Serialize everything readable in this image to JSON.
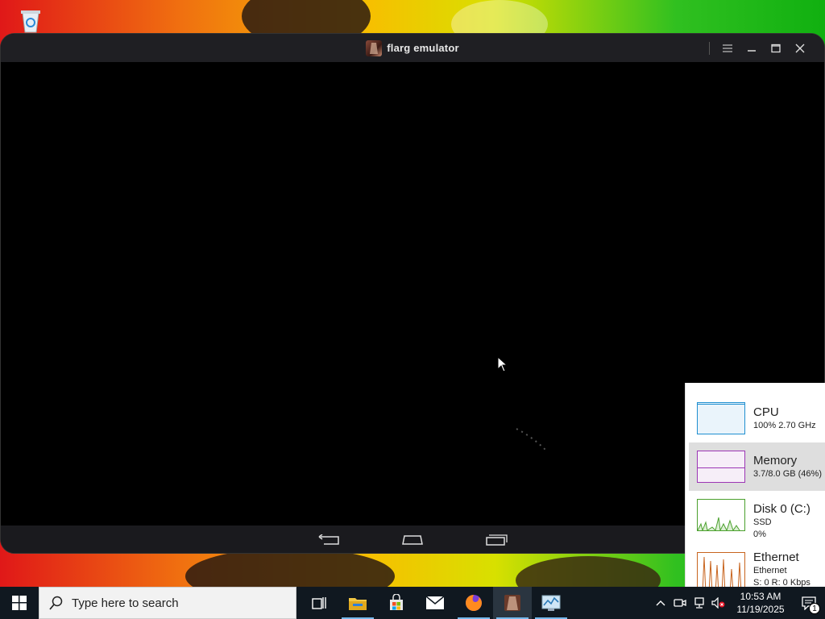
{
  "desktop": {
    "recycle_bin_icon": "recycle-bin-icon"
  },
  "emulator": {
    "title": "flarg emulator",
    "controls": [
      "menu-icon",
      "minimize-icon",
      "maximize-icon",
      "close-icon"
    ],
    "navbar": [
      "back-icon",
      "home-icon",
      "recents-icon"
    ]
  },
  "perf_panel": {
    "items": [
      {
        "name": "CPU",
        "line1": "100%  2.70 GHz",
        "line2": "",
        "color": "#1f8fd0"
      },
      {
        "name": "Memory",
        "line1": "3.7/8.0 GB (46%)",
        "line2": "",
        "color": "#9c36b5"
      },
      {
        "name": "Disk 0 (C:)",
        "line1": "SSD",
        "line2": "0%",
        "color": "#4aa02c"
      },
      {
        "name": "Ethernet",
        "line1": "Ethernet",
        "line2": "S: 0  R: 0 Kbps",
        "color": "#c8641e"
      }
    ]
  },
  "taskbar": {
    "search_placeholder": "Type here to search",
    "apps": [
      "task-view-icon",
      "file-explorer-icon",
      "store-icon",
      "mail-icon",
      "firefox-icon",
      "flarg-emulator-icon",
      "task-manager-icon"
    ],
    "tray": {
      "time": "10:53 AM",
      "date": "11/19/2025",
      "notification_count": "1"
    }
  }
}
